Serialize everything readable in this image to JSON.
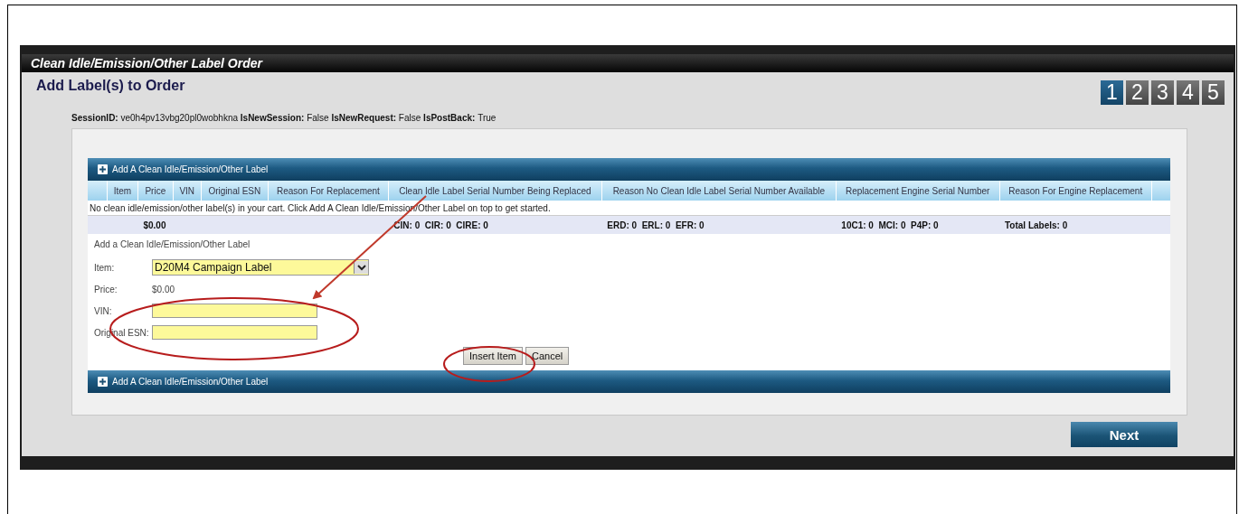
{
  "window": {
    "title": "Clean Idle/Emission/Other Label Order"
  },
  "page_title": "Add Label(s) to Order",
  "steps": [
    {
      "label": "1",
      "selected": true
    },
    {
      "label": "2",
      "selected": false
    },
    {
      "label": "3",
      "selected": false
    },
    {
      "label": "4",
      "selected": false
    },
    {
      "label": "5",
      "selected": false
    }
  ],
  "session_info": [
    {
      "key": "SessionID:",
      "value": "ve0h4pv13vbg20pl0wobhkna"
    },
    {
      "key": "IsNewSession:",
      "value": "False"
    },
    {
      "key": "IsNewRequest:",
      "value": "False"
    },
    {
      "key": "IsPostBack:",
      "value": "True"
    }
  ],
  "add_bar_top": {
    "label": "Add A Clean Idle/Emission/Other Label"
  },
  "table": {
    "columns": [
      "Item",
      "Price",
      "VIN",
      "Original ESN",
      "Reason For Replacement",
      "Clean Idle Label Serial Number Being Replaced",
      "Reason No Clean Idle Label Serial Number Available",
      "Replacement Engine Serial Number",
      "Reason For Engine Replacement"
    ],
    "empty_message": "No clean idle/emission/other label(s) in your cart. Click Add A Clean Idle/Emission/Other Label on top to get started.",
    "summary": {
      "price_total": "$0.00",
      "clean_idle_counts": "CIN: 0  CIR: 0  CIRE: 0",
      "reason_counts": "ERD: 0  ERL: 0  EFR: 0",
      "engine_counts": "10C1: 0  MCI: 0  P4P: 0",
      "total_labels": "Total Labels: 0"
    }
  },
  "form": {
    "heading": "Add a Clean Idle/Emission/Other Label",
    "fields": [
      {
        "kind": "select",
        "label": "Item:",
        "value": "D20M4 Campaign Label"
      },
      {
        "kind": "text",
        "label": "Price:",
        "value": "$0.00"
      },
      {
        "kind": "input",
        "label": "VIN:"
      },
      {
        "kind": "input",
        "label": "Original ESN:"
      }
    ],
    "buttons": [
      "Insert Item",
      "Cancel"
    ]
  },
  "add_bar_bottom": {
    "label": "Add A Clean Idle/Emission/Other Label"
  },
  "next_button": "Next"
}
